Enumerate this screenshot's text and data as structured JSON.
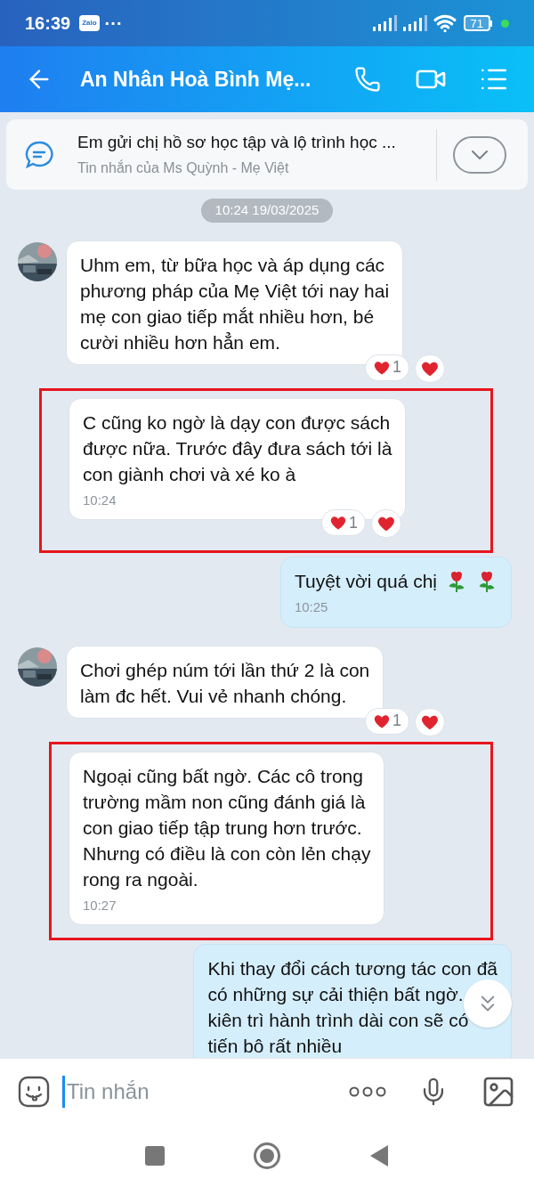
{
  "status_bar": {
    "time": "16:39",
    "app_badge": "Zalo",
    "more": "···",
    "battery": "71"
  },
  "header": {
    "title": "An Nhân Hoà Bình Mẹ..."
  },
  "pinned": {
    "text": "Em gửi chị hồ sơ học tập và lộ trình học ...",
    "subtitle": "Tin nhắn của Ms Quỳnh - Mẹ Việt"
  },
  "date_label": "10:24 19/03/2025",
  "messages": [
    {
      "kind": "received",
      "avatar": true,
      "highlighted": false,
      "lines": [
        "Uhm em, từ bữa học và áp dụng các",
        "phương pháp của Mẹ Việt tới nay hai",
        "mẹ con giao tiếp mắt nhiều hơn, bé",
        "cười nhiều hơn hẳn em."
      ],
      "reaction_count": "1"
    },
    {
      "kind": "received",
      "avatar": false,
      "highlighted": true,
      "lines": [
        "C cũng ko ngờ là dạy con được sách",
        "được nữa. Trước đây đưa sách tới là",
        "con giành chơi và xé ko à"
      ],
      "time": "10:24",
      "reaction_count": "1"
    },
    {
      "kind": "sent",
      "avatar": false,
      "highlighted": false,
      "lines": [
        "Tuyệt vời quá chị"
      ],
      "emoji": [
        {
          "kind": "rose"
        },
        {
          "kind": "rose"
        }
      ],
      "time": "10:25"
    },
    {
      "kind": "received",
      "avatar": true,
      "highlighted": false,
      "lines": [
        "Chơi ghép núm tới lần thứ 2 là con",
        "làm đc hết. Vui vẻ nhanh chóng."
      ],
      "reaction_count": "1"
    },
    {
      "kind": "received",
      "avatar": false,
      "highlighted": true,
      "lines": [
        "Ngoại cũng bất ngờ. Các cô trong",
        "trường mầm non cũng đánh giá là",
        "con giao tiếp tập trung hơn trước.",
        "Nhưng có điều là con còn lẻn chạy",
        "rong ra ngoài."
      ],
      "time": "10:27"
    },
    {
      "kind": "sent",
      "avatar": false,
      "highlighted": false,
      "lines": [
        "Khi thay đổi cách tương tác con đã",
        "có những sự cải thiện bất ngờ.",
        "kiên trì hành trình dài con sẽ có",
        "tiến bô rất nhiều"
      ]
    }
  ],
  "composer": {
    "placeholder": "Tin nhắn"
  }
}
